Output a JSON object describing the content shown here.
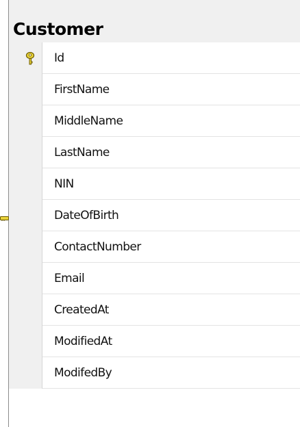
{
  "table": {
    "title": "Customer",
    "columns": [
      {
        "label": "Id",
        "primary_key": true
      },
      {
        "label": "FirstName",
        "primary_key": false
      },
      {
        "label": "MiddleName",
        "primary_key": false
      },
      {
        "label": "LastName",
        "primary_key": false
      },
      {
        "label": "NIN",
        "primary_key": false
      },
      {
        "label": "DateOfBirth",
        "primary_key": false
      },
      {
        "label": "ContactNumber",
        "primary_key": false
      },
      {
        "label": "Email",
        "primary_key": false
      },
      {
        "label": "CreatedAt",
        "primary_key": false
      },
      {
        "label": "ModifiedAt",
        "primary_key": false
      },
      {
        "label": "ModifedBy",
        "primary_key": false
      }
    ]
  },
  "icons": {
    "primary_key": "key-icon",
    "relationship": "relationship-key-icon"
  },
  "colors": {
    "key_fill": "#e8d23a",
    "key_stroke": "#6b5a00",
    "header_bg": "#f0f0f0",
    "border": "#8c8c8c"
  }
}
